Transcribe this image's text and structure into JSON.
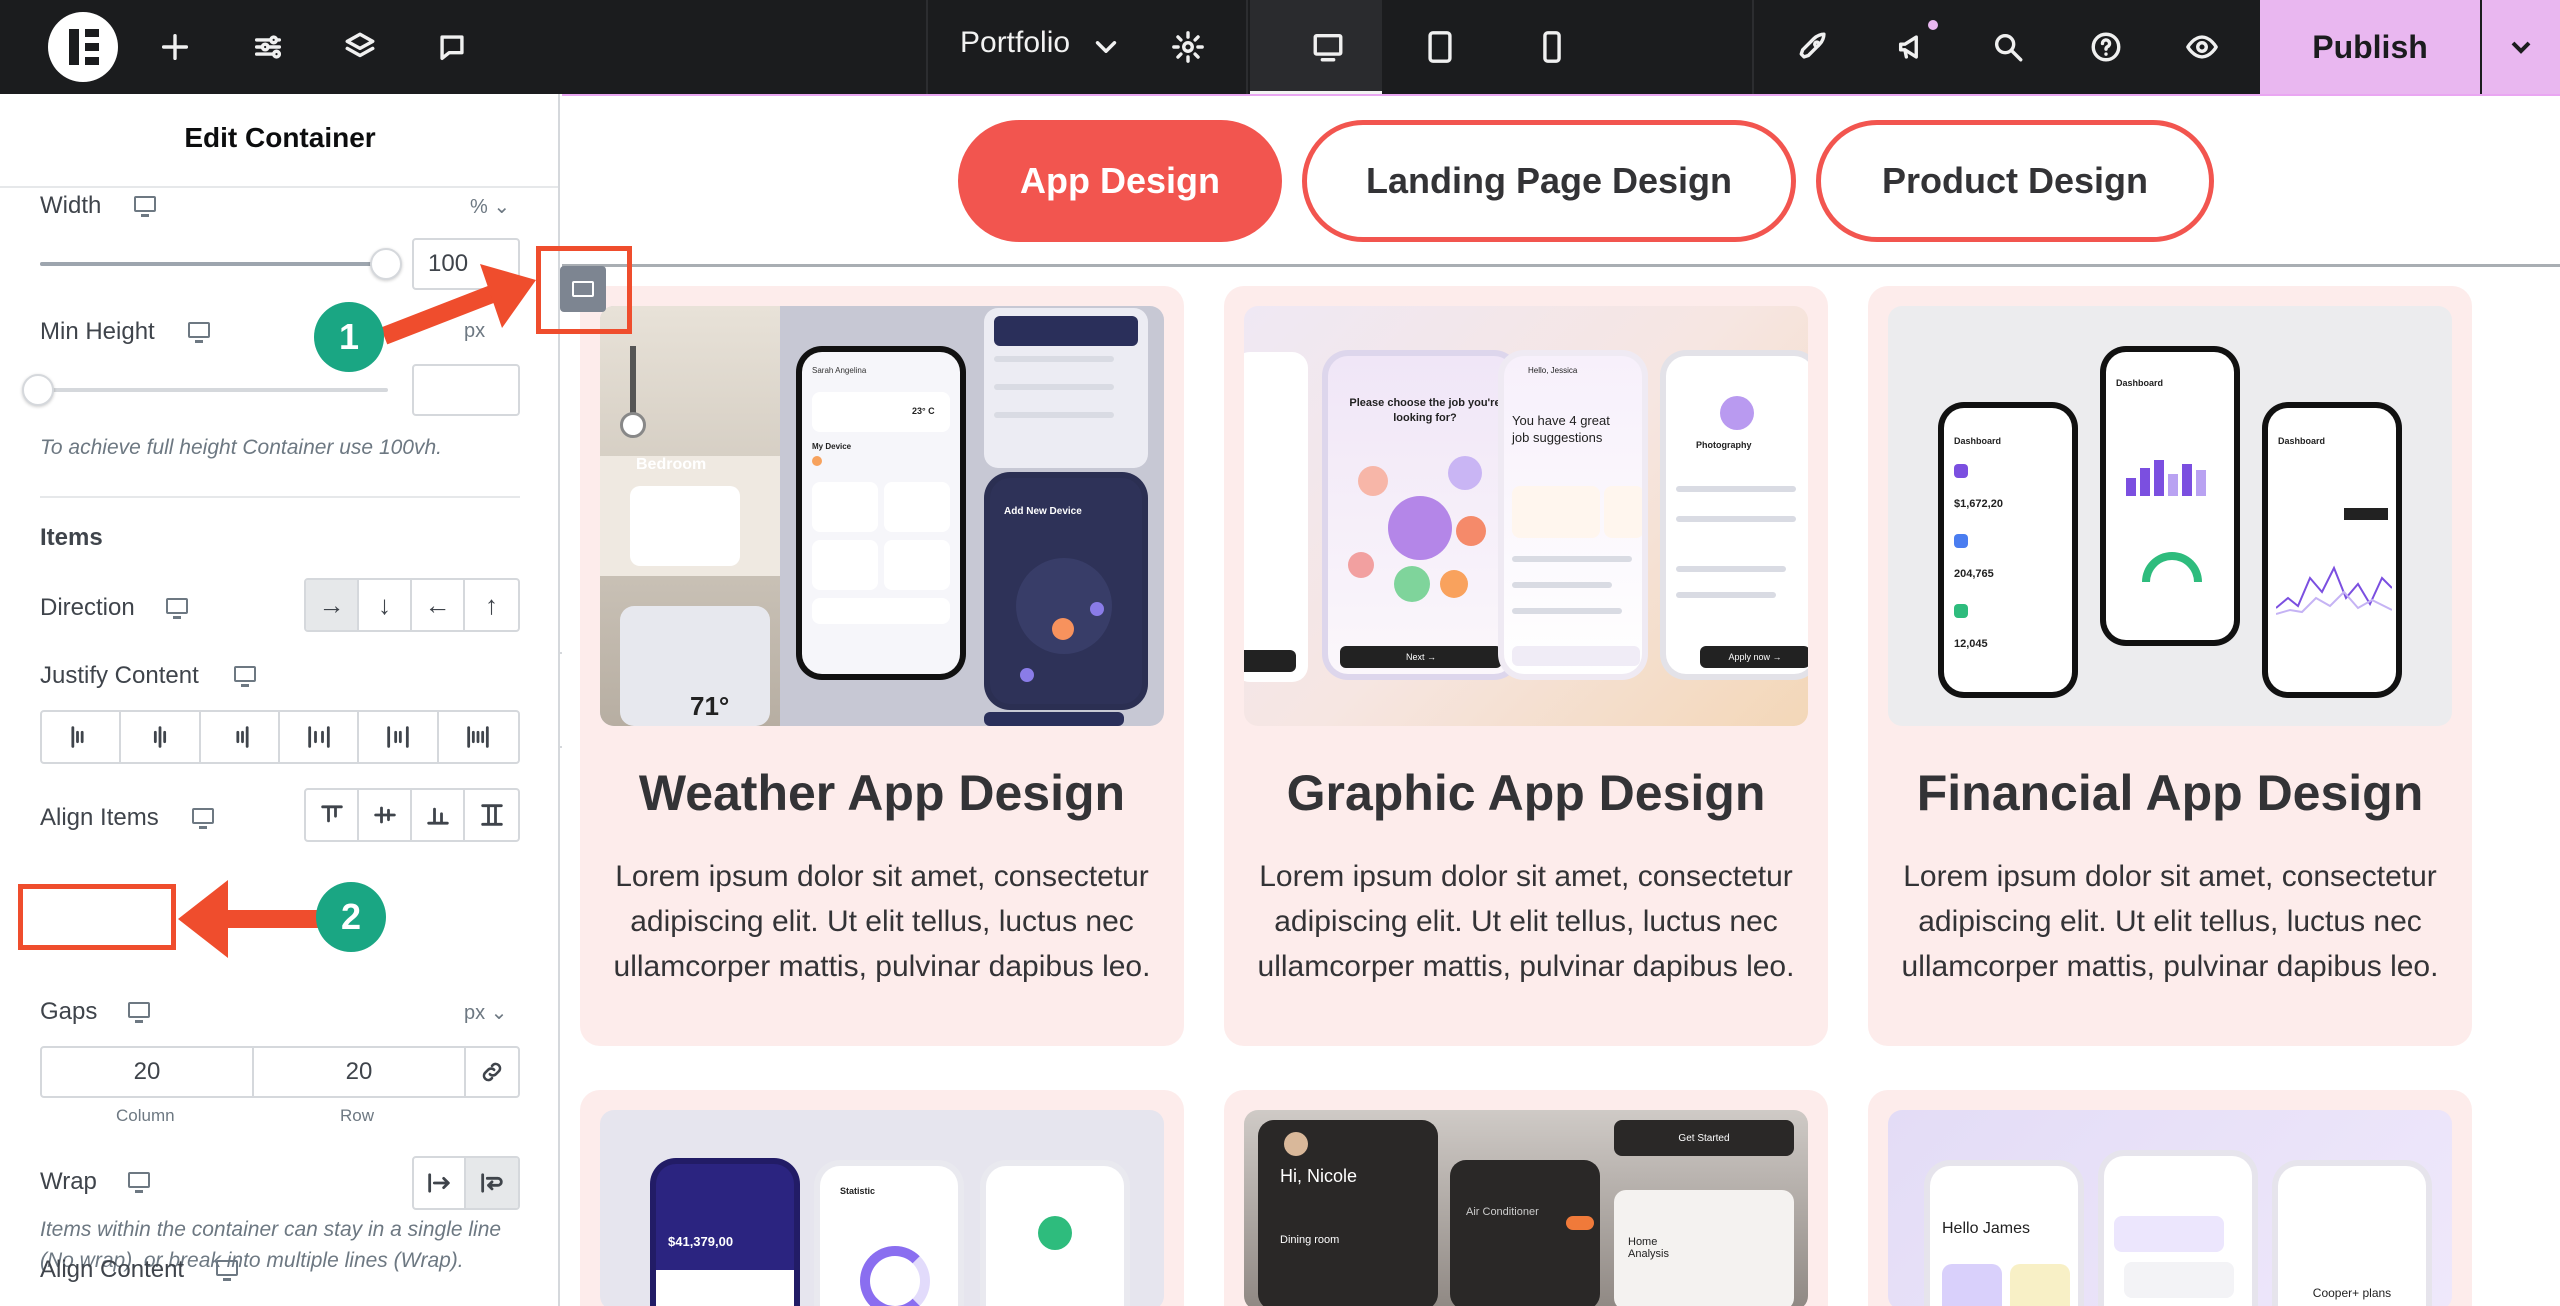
{
  "topbar": {
    "site_name": "Portfolio",
    "publish_label": "Publish",
    "icons": [
      "elementor-logo-icon",
      "add-icon",
      "settings-sliders-icon",
      "layers-icon",
      "comments-icon",
      "chevron-down-icon",
      "gear-icon",
      "desktop-icon",
      "tablet-icon",
      "mobile-icon",
      "rocket-icon",
      "announcement-icon",
      "search-icon",
      "help-icon",
      "eye-icon"
    ],
    "accent": "#e9b7f0"
  },
  "panel": {
    "title": "Edit Container",
    "width": {
      "label": "Width",
      "unit": "%",
      "value": "100",
      "fraction": 1.0
    },
    "min_height": {
      "label": "Min Height",
      "unit": "px",
      "value": "",
      "hint": "To achieve full height Container use 100vh."
    },
    "items_heading": "Items",
    "direction": {
      "label": "Direction",
      "options": [
        "→",
        "↓",
        "←",
        "↑"
      ],
      "active": 0
    },
    "justify_content": {
      "label": "Justify Content"
    },
    "align_items": {
      "label": "Align Items"
    },
    "gaps": {
      "label": "Gaps",
      "unit": "px",
      "column": "20",
      "row": "20",
      "column_label": "Column",
      "row_label": "Row"
    },
    "wrap": {
      "label": "Wrap",
      "hint": "Items within the container can stay in a single line (No wrap), or break into multiple lines (Wrap)."
    },
    "align_content": {
      "label": "Align Content"
    }
  },
  "annotations": {
    "step1": "1",
    "step2": "2",
    "color": "#ef4d2d",
    "badge_color": "#1aa683"
  },
  "canvas": {
    "tabs": [
      "App Design",
      "Landing Page Design",
      "Product Design"
    ],
    "accent": "#f2554f",
    "cards": [
      {
        "title": "Weather App Design",
        "desc": "Lorem ipsum dolor sit amet, consectetur adipiscing elit. Ut elit tellus, luctus nec ullamcorper mattis, pulvinar dapibus leo."
      },
      {
        "title": "Graphic App Design",
        "desc": "Lorem ipsum dolor sit amet, consectetur adipiscing elit. Ut elit tellus, luctus nec ullamcorper mattis, pulvinar dapibus leo."
      },
      {
        "title": "Financial App Design",
        "desc": "Lorem ipsum dolor sit amet, consectetur adipiscing elit. Ut elit tellus, luctus nec ullamcorper mattis, pulvinar dapibus leo."
      }
    ],
    "weather_img": {
      "room": "Bedroom",
      "temp": "71°",
      "add_device": "Add New Device",
      "my_device": "My Device",
      "user": "Sarah Angelina",
      "indoor": "23° C"
    },
    "graphic_img": {
      "question": "Please choose the job you're looking for?",
      "greeting": "Hello, Jessica",
      "suggestions": "You have 4 great job suggestions",
      "next": "Next →",
      "apply": "Apply now →",
      "photography": "Photography"
    },
    "financial_img": {
      "dashboard": "Dashboard",
      "amount": "$1,672,20",
      "metric": "204,765",
      "metric2": "12,045"
    },
    "row2": {
      "nicole": "Hi, Nicole",
      "hello_james": "Hello James",
      "balance": "$41,379,00",
      "statistic": "Statistic",
      "air": "Air Conditioner",
      "home_analysis": "Home Analysis",
      "dining": "Dining room",
      "cooper": "Cooper+ plans",
      "get_started": "Get Started"
    }
  }
}
